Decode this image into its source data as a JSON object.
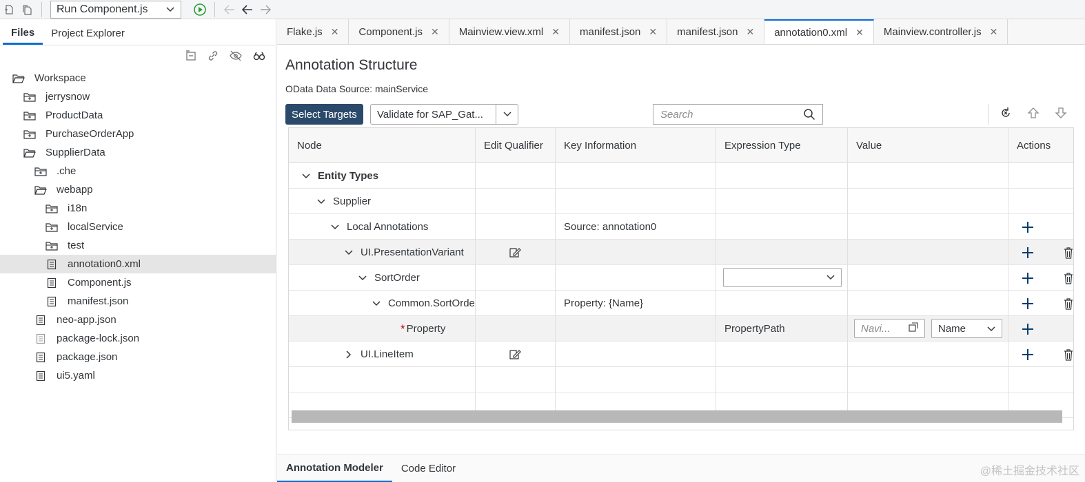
{
  "toolbar": {
    "run_config": "Run Component.js"
  },
  "left_panel": {
    "tabs": [
      "Files",
      "Project Explorer"
    ],
    "tree": [
      {
        "label": "Workspace",
        "icon": "folder-open-icon",
        "depth": 0,
        "selected": false
      },
      {
        "label": "jerrysnow",
        "icon": "folder-closed-icon",
        "depth": 1,
        "selected": false
      },
      {
        "label": "ProductData",
        "icon": "folder-closed-icon",
        "depth": 1,
        "selected": false
      },
      {
        "label": "PurchaseOrderApp",
        "icon": "folder-closed-icon",
        "depth": 1,
        "selected": false
      },
      {
        "label": "SupplierData",
        "icon": "folder-open-icon",
        "depth": 1,
        "selected": false
      },
      {
        "label": ".che",
        "icon": "folder-closed-icon",
        "depth": 2,
        "selected": false
      },
      {
        "label": "webapp",
        "icon": "folder-open-icon",
        "depth": 2,
        "selected": false
      },
      {
        "label": "i18n",
        "icon": "folder-closed-icon",
        "depth": 3,
        "selected": false
      },
      {
        "label": "localService",
        "icon": "folder-closed-icon",
        "depth": 3,
        "selected": false
      },
      {
        "label": "test",
        "icon": "folder-closed-icon",
        "depth": 3,
        "selected": false
      },
      {
        "label": "annotation0.xml",
        "icon": "file-icon",
        "depth": 3,
        "selected": true
      },
      {
        "label": "Component.js",
        "icon": "file-icon",
        "depth": 3,
        "selected": false
      },
      {
        "label": "manifest.json",
        "icon": "file-icon",
        "depth": 3,
        "selected": false
      },
      {
        "label": "neo-app.json",
        "icon": "file-icon",
        "depth": 2,
        "selected": false
      },
      {
        "label": "package-lock.json",
        "icon": "file-icon",
        "depth": 2,
        "selected": false
      },
      {
        "label": "package.json",
        "icon": "file-icon",
        "depth": 2,
        "selected": false
      },
      {
        "label": "ui5.yaml",
        "icon": "file-icon",
        "depth": 2,
        "selected": false
      }
    ]
  },
  "editor_tabs": [
    {
      "label": "Flake.js",
      "active": false
    },
    {
      "label": "Component.js",
      "active": false
    },
    {
      "label": "Mainview.view.xml",
      "active": false
    },
    {
      "label": "manifest.json",
      "active": false
    },
    {
      "label": "manifest.json",
      "active": false
    },
    {
      "label": "annotation0.xml",
      "active": true
    },
    {
      "label": "Mainview.controller.js",
      "active": false
    }
  ],
  "tab_close_glyph": "✕",
  "main": {
    "title": "Annotation Structure",
    "subtitle": "OData Data Source: mainService",
    "select_targets": "Select Targets",
    "validate_label": "Validate for SAP_Gat...",
    "search_placeholder": "Search"
  },
  "table": {
    "columns": [
      "Node",
      "Edit Qualifier",
      "Key Information",
      "Expression Type",
      "Value",
      "Actions"
    ],
    "rows": [
      {
        "node": "Entity Types",
        "level": 0,
        "expanded": true,
        "bold": true,
        "edit_qualifier": false,
        "key_info": "",
        "expr_type": "",
        "expr_select": false,
        "value_input": "",
        "value_select": "",
        "add": false,
        "delete": false,
        "required": false,
        "alt": false
      },
      {
        "node": "Supplier",
        "level": 1,
        "expanded": true,
        "bold": false,
        "edit_qualifier": false,
        "key_info": "",
        "expr_type": "",
        "expr_select": false,
        "value_input": "",
        "value_select": "",
        "add": false,
        "delete": false,
        "required": false,
        "alt": false
      },
      {
        "node": "Local Annotations",
        "level": 2,
        "expanded": true,
        "bold": false,
        "edit_qualifier": false,
        "key_info": "Source: annotation0",
        "expr_type": "",
        "expr_select": false,
        "value_input": "",
        "value_select": "",
        "add": true,
        "delete": false,
        "required": false,
        "alt": false
      },
      {
        "node": "UI.PresentationVariant",
        "level": 3,
        "expanded": true,
        "bold": false,
        "edit_qualifier": true,
        "key_info": "",
        "expr_type": "",
        "expr_select": false,
        "value_input": "",
        "value_select": "",
        "add": true,
        "delete": true,
        "required": false,
        "alt": true
      },
      {
        "node": "SortOrder",
        "level": 4,
        "expanded": true,
        "bold": false,
        "edit_qualifier": false,
        "key_info": "",
        "expr_type": "",
        "expr_select": true,
        "value_input": "",
        "value_select": "",
        "add": true,
        "delete": true,
        "required": false,
        "alt": false
      },
      {
        "node": "Common.SortOrde",
        "level": 5,
        "expanded": true,
        "bold": false,
        "edit_qualifier": false,
        "key_info": "Property: {Name}",
        "expr_type": "",
        "expr_select": false,
        "value_input": "",
        "value_select": "",
        "add": true,
        "delete": true,
        "required": false,
        "alt": false
      },
      {
        "node": "Property",
        "level": 6,
        "expanded": null,
        "bold": false,
        "edit_qualifier": false,
        "key_info": "",
        "expr_type": "PropertyPath",
        "expr_select": false,
        "value_input": "Navi...",
        "value_select": "Name",
        "add": true,
        "delete": false,
        "required": true,
        "alt": true
      },
      {
        "node": "UI.LineItem",
        "level": 3,
        "expanded": false,
        "bold": false,
        "edit_qualifier": true,
        "key_info": "",
        "expr_type": "",
        "expr_select": false,
        "value_input": "",
        "value_select": "",
        "add": true,
        "delete": true,
        "required": false,
        "alt": false
      }
    ]
  },
  "bottom_tabs": [
    {
      "label": "Annotation Modeler",
      "active": true
    },
    {
      "label": "Code Editor",
      "active": false
    }
  ],
  "watermark": "@稀土掘金技术社区"
}
